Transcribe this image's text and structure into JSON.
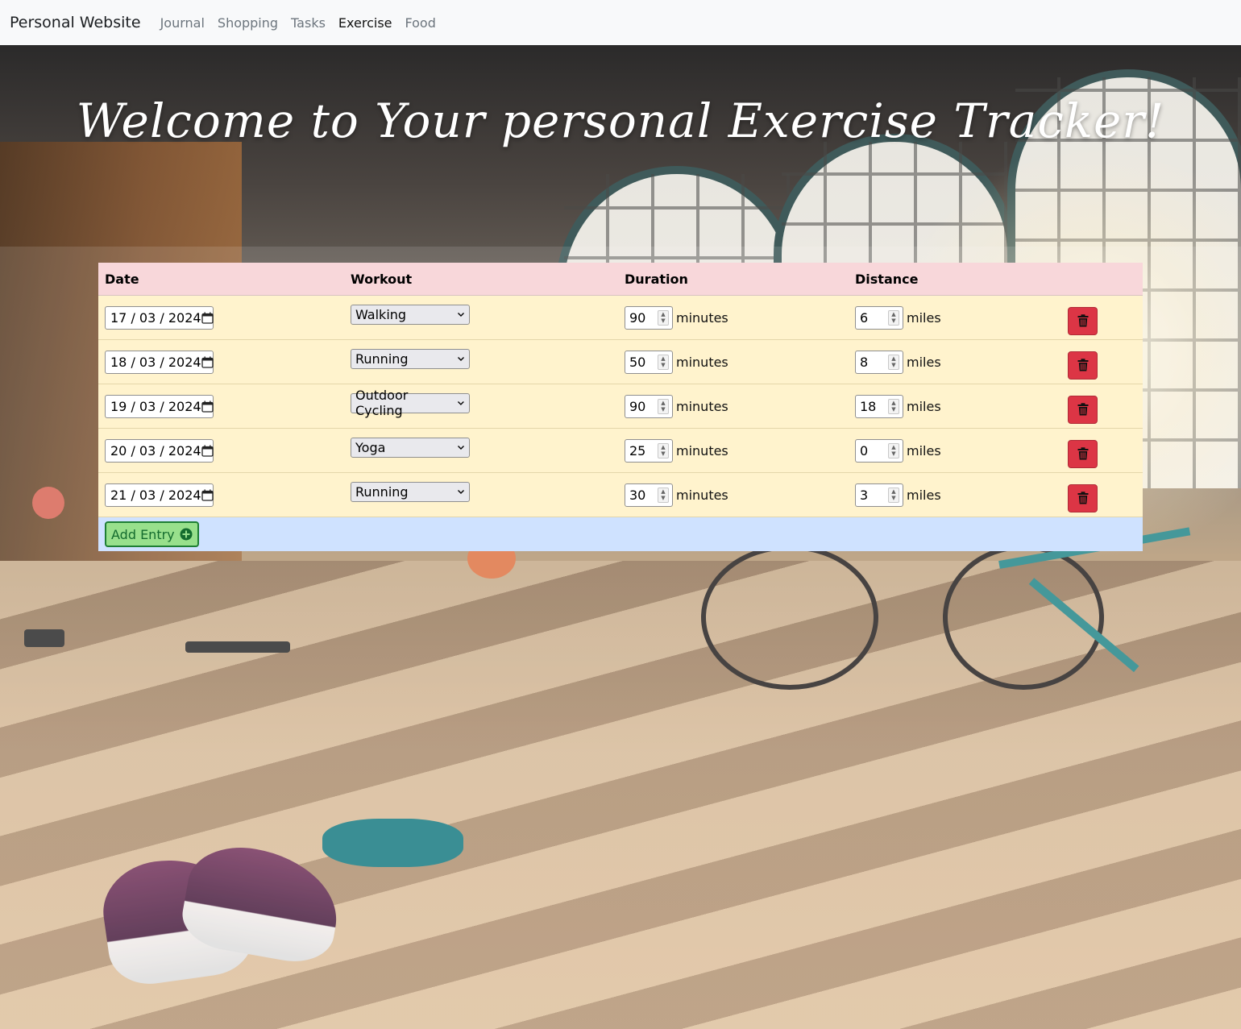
{
  "navbar": {
    "brand": "Personal Website",
    "links": [
      {
        "label": "Journal",
        "active": false
      },
      {
        "label": "Shopping",
        "active": false
      },
      {
        "label": "Tasks",
        "active": false
      },
      {
        "label": "Exercise",
        "active": true
      },
      {
        "label": "Food",
        "active": false
      }
    ]
  },
  "heading": "Welcome to Your personal Exercise Tracker!",
  "table": {
    "headers": {
      "date": "Date",
      "workout": "Workout",
      "duration": "Duration",
      "distance": "Distance"
    },
    "rows": [
      {
        "day": "17",
        "month": "03",
        "year": "2024",
        "workout": "Walking",
        "duration": "90",
        "duration_unit": "minutes",
        "distance": "6",
        "distance_unit": "miles"
      },
      {
        "day": "18",
        "month": "03",
        "year": "2024",
        "workout": "Running",
        "duration": "50",
        "duration_unit": "minutes",
        "distance": "8",
        "distance_unit": "miles"
      },
      {
        "day": "19",
        "month": "03",
        "year": "2024",
        "workout": "Outdoor Cycling",
        "duration": "90",
        "duration_unit": "minutes",
        "distance": "18",
        "distance_unit": "miles"
      },
      {
        "day": "20",
        "month": "03",
        "year": "2024",
        "workout": "Yoga",
        "duration": "25",
        "duration_unit": "minutes",
        "distance": "0",
        "distance_unit": "miles"
      },
      {
        "day": "21",
        "month": "03",
        "year": "2024",
        "workout": "Running",
        "duration": "30",
        "duration_unit": "minutes",
        "distance": "3",
        "distance_unit": "miles"
      }
    ],
    "add_label": "Add Entry"
  },
  "icons": {
    "calendar": "calendar-icon",
    "chevron": "chevron-down-icon",
    "delete": "trash-icon",
    "add": "plus-circle-icon"
  },
  "colors": {
    "header_row": "#f8d7da",
    "body_row": "#fff3cd",
    "footer_row": "#cfe2ff",
    "delete_button": "#dc3545",
    "add_button": "#98e08c"
  }
}
